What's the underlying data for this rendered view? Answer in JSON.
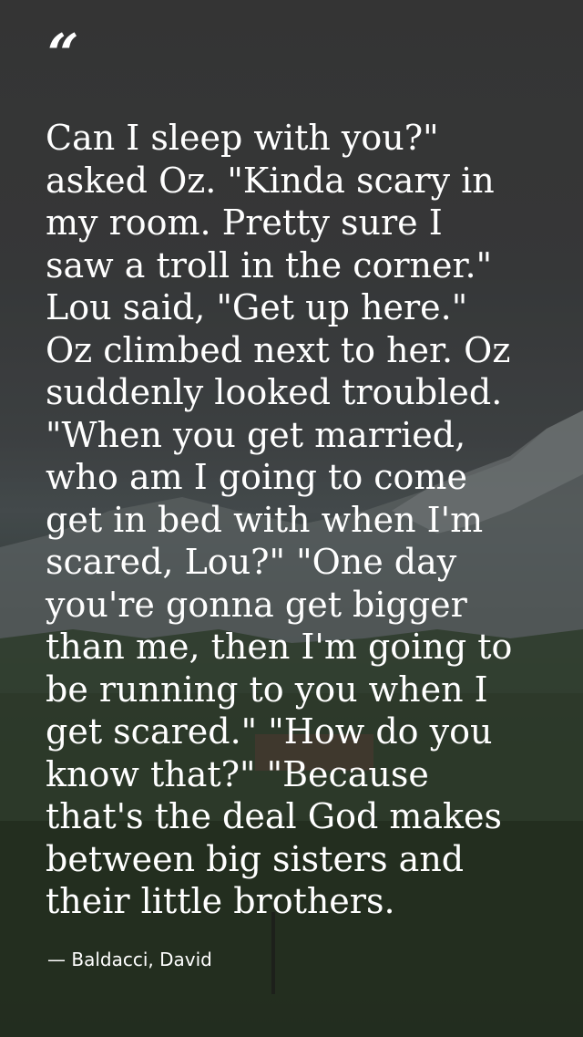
{
  "quote": {
    "mark": "“",
    "lines": [
      "Can I sleep with you?\"",
      "asked Oz. \"Kinda scary in",
      "my room. Pretty sure I",
      "saw a troll in the corner.\"",
      "Lou said, \"Get up here.\"",
      "Oz climbed next to her. Oz",
      "suddenly looked troubled.",
      "\"When you get married,",
      "who am I going to come",
      "get in bed with when I'm",
      "scared, Lou?\" \"One day",
      "you're gonna get bigger",
      "than me, then I'm going to",
      "be running to you when I",
      "get scared.\" \"How do you",
      "know that?\" \"Because",
      "that's the deal God makes",
      "between big sisters and",
      "their little brothers."
    ],
    "author": "— Baldacci, David"
  },
  "colors": {
    "text": "#ffffff",
    "sky": "#3b3b3b",
    "mountains": "#6f7474",
    "forest": "#2c3a2c"
  }
}
